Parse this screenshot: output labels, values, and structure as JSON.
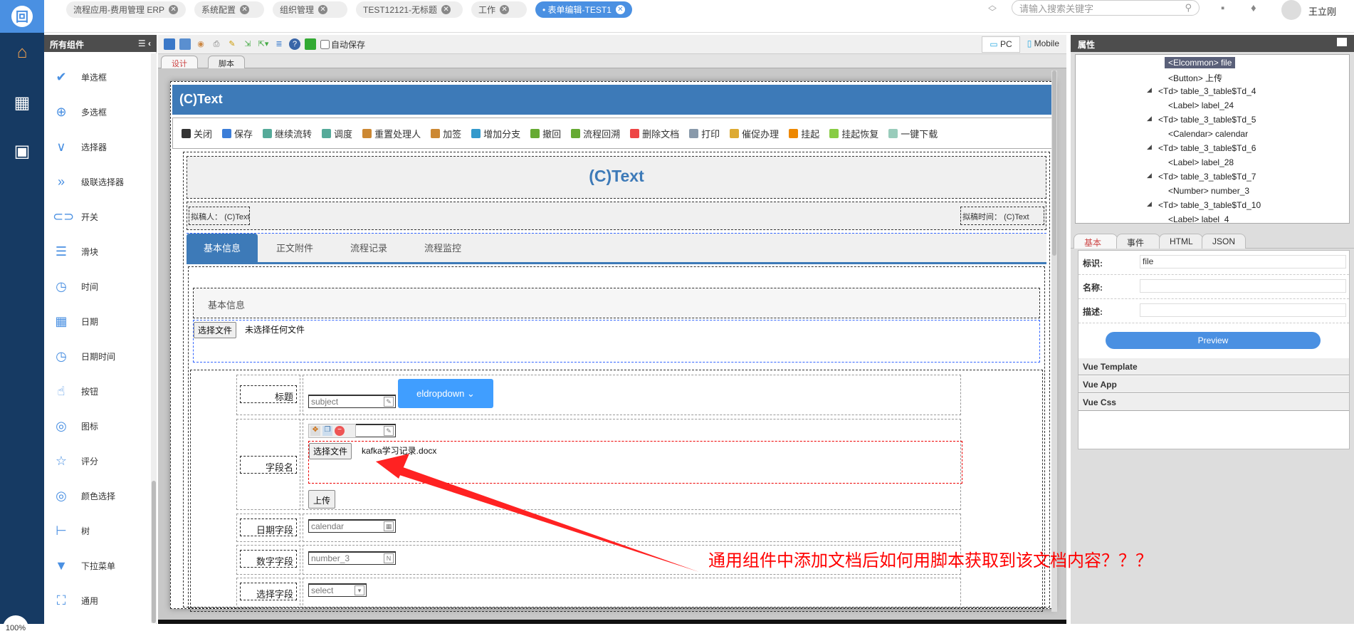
{
  "top_tabs": [
    {
      "label": "流程应用-费用管理 ERP",
      "active": false
    },
    {
      "label": "系统配置",
      "active": false
    },
    {
      "label": "组织管理",
      "active": false
    },
    {
      "label": "TEST12121-无标题",
      "active": false
    },
    {
      "label": "工作",
      "active": false
    },
    {
      "label": "• 表单编辑-TEST1",
      "active": true
    }
  ],
  "search": {
    "placeholder": "请输入搜索关键字"
  },
  "user": {
    "name": "王立刚"
  },
  "zoom": "100%",
  "components": {
    "title": "所有组件",
    "items": [
      {
        "label": "单选框",
        "icon": "check-circle-icon",
        "glyph": "✔"
      },
      {
        "label": "多选框",
        "icon": "plus-circle-icon",
        "glyph": "⊕"
      },
      {
        "label": "选择器",
        "icon": "chevron-down-icon",
        "glyph": "∨"
      },
      {
        "label": "级联选择器",
        "icon": "double-chevron-icon",
        "glyph": "»"
      },
      {
        "label": "开关",
        "icon": "toggle-icon",
        "glyph": "⊂⊃"
      },
      {
        "label": "滑块",
        "icon": "sliders-icon",
        "glyph": "☰"
      },
      {
        "label": "时间",
        "icon": "clock-icon",
        "glyph": "◷"
      },
      {
        "label": "日期",
        "icon": "calendar-icon",
        "glyph": "▦"
      },
      {
        "label": "日期时间",
        "icon": "clock-icon",
        "glyph": "◷"
      },
      {
        "label": "按钮",
        "icon": "hand-pointer-icon",
        "glyph": "☝"
      },
      {
        "label": "图标",
        "icon": "image-icon",
        "glyph": "◎"
      },
      {
        "label": "评分",
        "icon": "star-icon",
        "glyph": "☆"
      },
      {
        "label": "颜色选择",
        "icon": "color-ring-icon",
        "glyph": "◎"
      },
      {
        "label": "树",
        "icon": "tree-icon",
        "glyph": "⊢"
      },
      {
        "label": "下拉菜单",
        "icon": "caret-down-icon",
        "glyph": "▼"
      },
      {
        "label": "通用",
        "icon": "expand-icon",
        "glyph": "⛶"
      }
    ]
  },
  "toolbar": {
    "autosave_label": "自动保存",
    "pc_label": "PC",
    "mobile_label": "Mobile"
  },
  "editor_tabs": {
    "design": "设计",
    "script": "脚本"
  },
  "form": {
    "header_title": "(C)Text",
    "actions": [
      {
        "label": "关闭",
        "color": "#333"
      },
      {
        "label": "保存",
        "color": "#3b7dd8"
      },
      {
        "label": "继续流转",
        "color": "#5a9"
      },
      {
        "label": "调度",
        "color": "#5a9"
      },
      {
        "label": "重置处理人",
        "color": "#c83"
      },
      {
        "label": "加签",
        "color": "#c83"
      },
      {
        "label": "增加分支",
        "color": "#39c"
      },
      {
        "label": "撤回",
        "color": "#6a3"
      },
      {
        "label": "流程回溯",
        "color": "#6a3"
      },
      {
        "label": "删除文档",
        "color": "#e44"
      },
      {
        "label": "打印",
        "color": "#89a"
      },
      {
        "label": "催促办理",
        "color": "#da3"
      },
      {
        "label": "挂起",
        "color": "#e80"
      },
      {
        "label": "挂起恢复",
        "color": "#8c4"
      },
      {
        "label": "一键下载",
        "color": "#9cb"
      }
    ],
    "title": "(C)Text",
    "drafter_label": "拟稿人：",
    "drafter_value": "(C)Text",
    "draft_time_label": "拟稿时间：",
    "draft_time_value": "(C)Text",
    "tabs": [
      "基本信息",
      "正文附件",
      "流程记录",
      "流程监控"
    ],
    "section_title": "基本信息",
    "choose_file": "选择文件",
    "no_file": "未选择任何文件",
    "fields": {
      "title_label": "标题",
      "subject": "subject",
      "dropdown": "eldropdown",
      "field_label": "字段名",
      "file_name": "kafka学习记录.docx",
      "upload": "上传",
      "date_label": "日期字段",
      "calendar": "calendar",
      "number_label": "数字字段",
      "number": "number_3",
      "select_label": "选择字段",
      "select": "select"
    }
  },
  "properties": {
    "title": "属性",
    "tree": [
      {
        "label": "<Elcommon> file",
        "level": 2,
        "selected": true
      },
      {
        "label": "<Button> 上传",
        "level": 2
      },
      {
        "label": "<Td> table_3_table$Td_4",
        "level": 1
      },
      {
        "label": "<Label> label_24",
        "level": 2
      },
      {
        "label": "<Td> table_3_table$Td_5",
        "level": 1
      },
      {
        "label": "<Calendar> calendar",
        "level": 2
      },
      {
        "label": "<Td> table_3_table$Td_6",
        "level": 1
      },
      {
        "label": "<Label> label_28",
        "level": 2
      },
      {
        "label": "<Td> table_3_table$Td_7",
        "level": 1
      },
      {
        "label": "<Number> number_3",
        "level": 2
      },
      {
        "label": "<Td> table_3_table$Td_10",
        "level": 1
      },
      {
        "label": "<Label> label_4",
        "level": 2
      }
    ],
    "tabs": [
      "基本",
      "事件",
      "HTML",
      "JSON"
    ],
    "id_label": "标识:",
    "id_value": "file",
    "name_label": "名称:",
    "desc_label": "描述:",
    "preview": "Preview",
    "sections": [
      "Vue Template",
      "Vue App",
      "Vue Css"
    ]
  },
  "annotation": "通用组件中添加文档后如何用脚本获取到该文档内容？？？",
  "colors": {
    "accent": "#4a90e2",
    "form_blue": "#3d7ab8",
    "nav": "#163a63",
    "annotation": "#ff0000"
  }
}
